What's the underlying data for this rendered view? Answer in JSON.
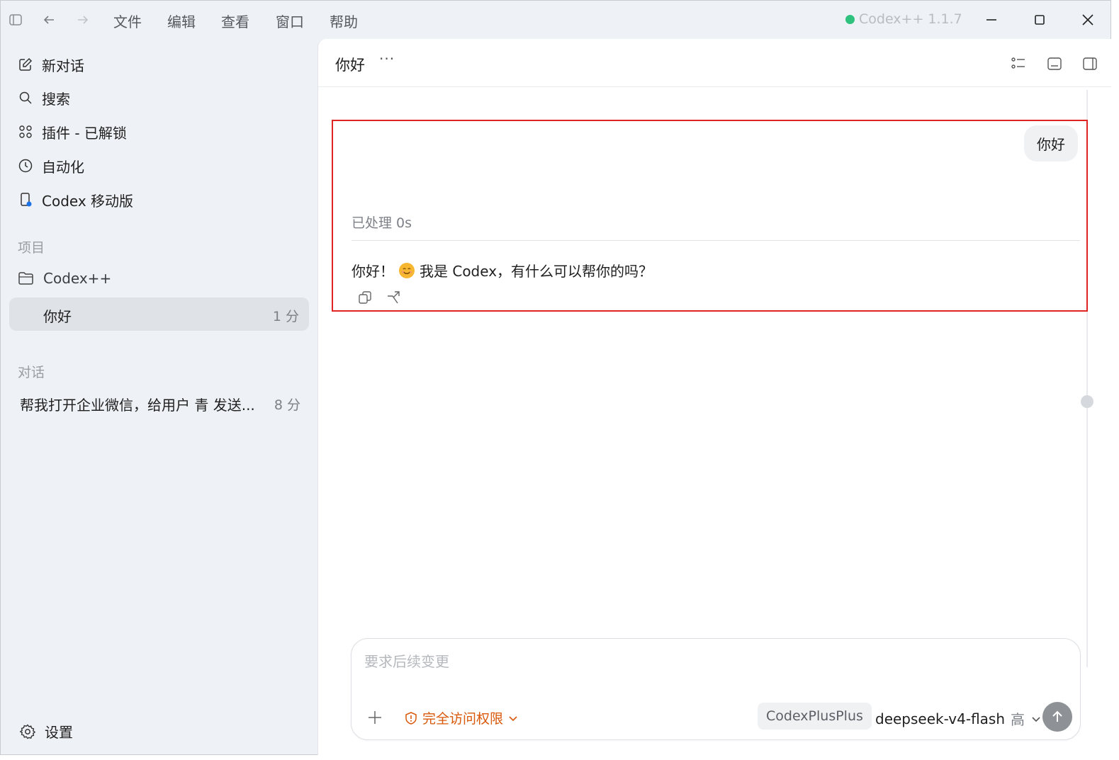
{
  "titlebar": {
    "menu": [
      "文件",
      "编辑",
      "查看",
      "窗口",
      "帮助"
    ],
    "app_version": "Codex++ 1.1.7"
  },
  "sidebar": {
    "nav": [
      {
        "label": "新对话",
        "icon": "edit-icon"
      },
      {
        "label": "搜索",
        "icon": "search-icon"
      },
      {
        "label": "插件 - 已解锁",
        "icon": "plugins-icon"
      },
      {
        "label": "自动化",
        "icon": "clock-icon"
      },
      {
        "label": "Codex 移动版",
        "icon": "mobile-icon"
      }
    ],
    "projects_label": "项目",
    "project_name": "Codex++",
    "active_thread": {
      "title": "你好",
      "time": "1 分"
    },
    "conversations_label": "对话",
    "conversation": {
      "title": "帮我打开企业微信，给用户 青 发送...",
      "time": "8 分"
    },
    "settings_label": "设置"
  },
  "main": {
    "title": "你好",
    "more": "···",
    "user_message": "你好",
    "processed": "已处理 0s",
    "assistant_message_before": "你好！",
    "assistant_message_after": "我是 Codex，有什么可以帮你的吗？"
  },
  "composer": {
    "placeholder": "要求后续变更",
    "permission": "完全访问权限",
    "provider": "CodexPlusPlus",
    "model": "deepseek-v4-flash",
    "level": "高"
  },
  "colors": {
    "accent_warning": "#d9580a",
    "status_dot": "#2ec27e",
    "highlight_border": "#e02424"
  }
}
